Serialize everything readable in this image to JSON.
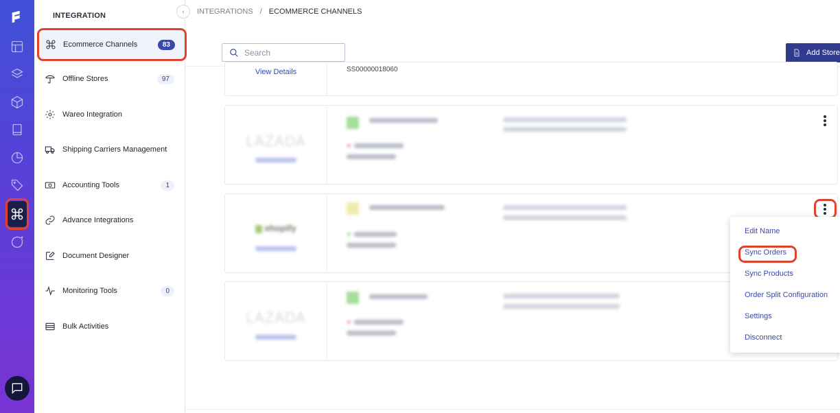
{
  "sidebar": {
    "heading": "INTEGRATION",
    "items": [
      {
        "label": "Ecommerce Channels",
        "badge": "83"
      },
      {
        "label": "Offline Stores",
        "badge": "97"
      },
      {
        "label": "Wareo Integration",
        "badge": ""
      },
      {
        "label": "Shipping Carriers Management",
        "badge": ""
      },
      {
        "label": "Accounting Tools",
        "badge": "1"
      },
      {
        "label": "Advance Integrations",
        "badge": ""
      },
      {
        "label": "Document Designer",
        "badge": ""
      },
      {
        "label": "Monitoring Tools",
        "badge": "0"
      },
      {
        "label": "Bulk Activities",
        "badge": ""
      }
    ]
  },
  "breadcrumb": {
    "parent": "INTEGRATIONS",
    "separator": "/",
    "current": "ECOMMERCE CHANNELS"
  },
  "search": {
    "placeholder": "Search"
  },
  "toolbar": {
    "add_store_label": "Add Store"
  },
  "cards": [
    {
      "view_label": "View Details",
      "store_id": "SS00000018060"
    },
    {
      "logo": "LAZADA"
    },
    {
      "logo": "shopify"
    },
    {
      "logo": "LAZADA"
    }
  ],
  "menu": {
    "items": [
      "Edit Name",
      "Sync Orders",
      "Sync Products",
      "Order Split Configuration",
      "Settings",
      "Disconnect"
    ]
  },
  "colors": {
    "accent": "#3949ab",
    "highlight": "#e0422c",
    "rail_top": "#3f51d6",
    "rail_bottom": "#7a33d4"
  }
}
